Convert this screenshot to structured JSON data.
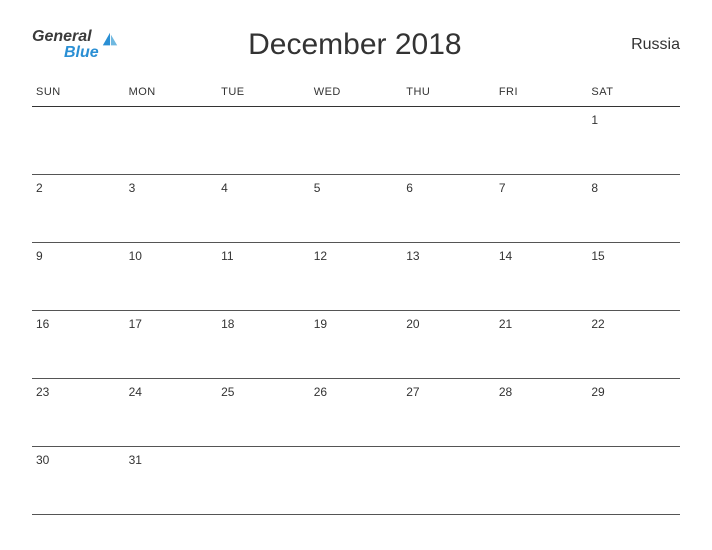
{
  "logo": {
    "general": "General",
    "blue": "Blue"
  },
  "title": "December 2018",
  "country": "Russia",
  "weekdays": [
    "SUN",
    "MON",
    "TUE",
    "WED",
    "THU",
    "FRI",
    "SAT"
  ],
  "grid": [
    [
      "",
      "",
      "",
      "",
      "",
      "",
      "1"
    ],
    [
      "2",
      "3",
      "4",
      "5",
      "6",
      "7",
      "8"
    ],
    [
      "9",
      "10",
      "11",
      "12",
      "13",
      "14",
      "15"
    ],
    [
      "16",
      "17",
      "18",
      "19",
      "20",
      "21",
      "22"
    ],
    [
      "23",
      "24",
      "25",
      "26",
      "27",
      "28",
      "29"
    ],
    [
      "30",
      "31",
      "",
      "",
      "",
      "",
      ""
    ]
  ]
}
